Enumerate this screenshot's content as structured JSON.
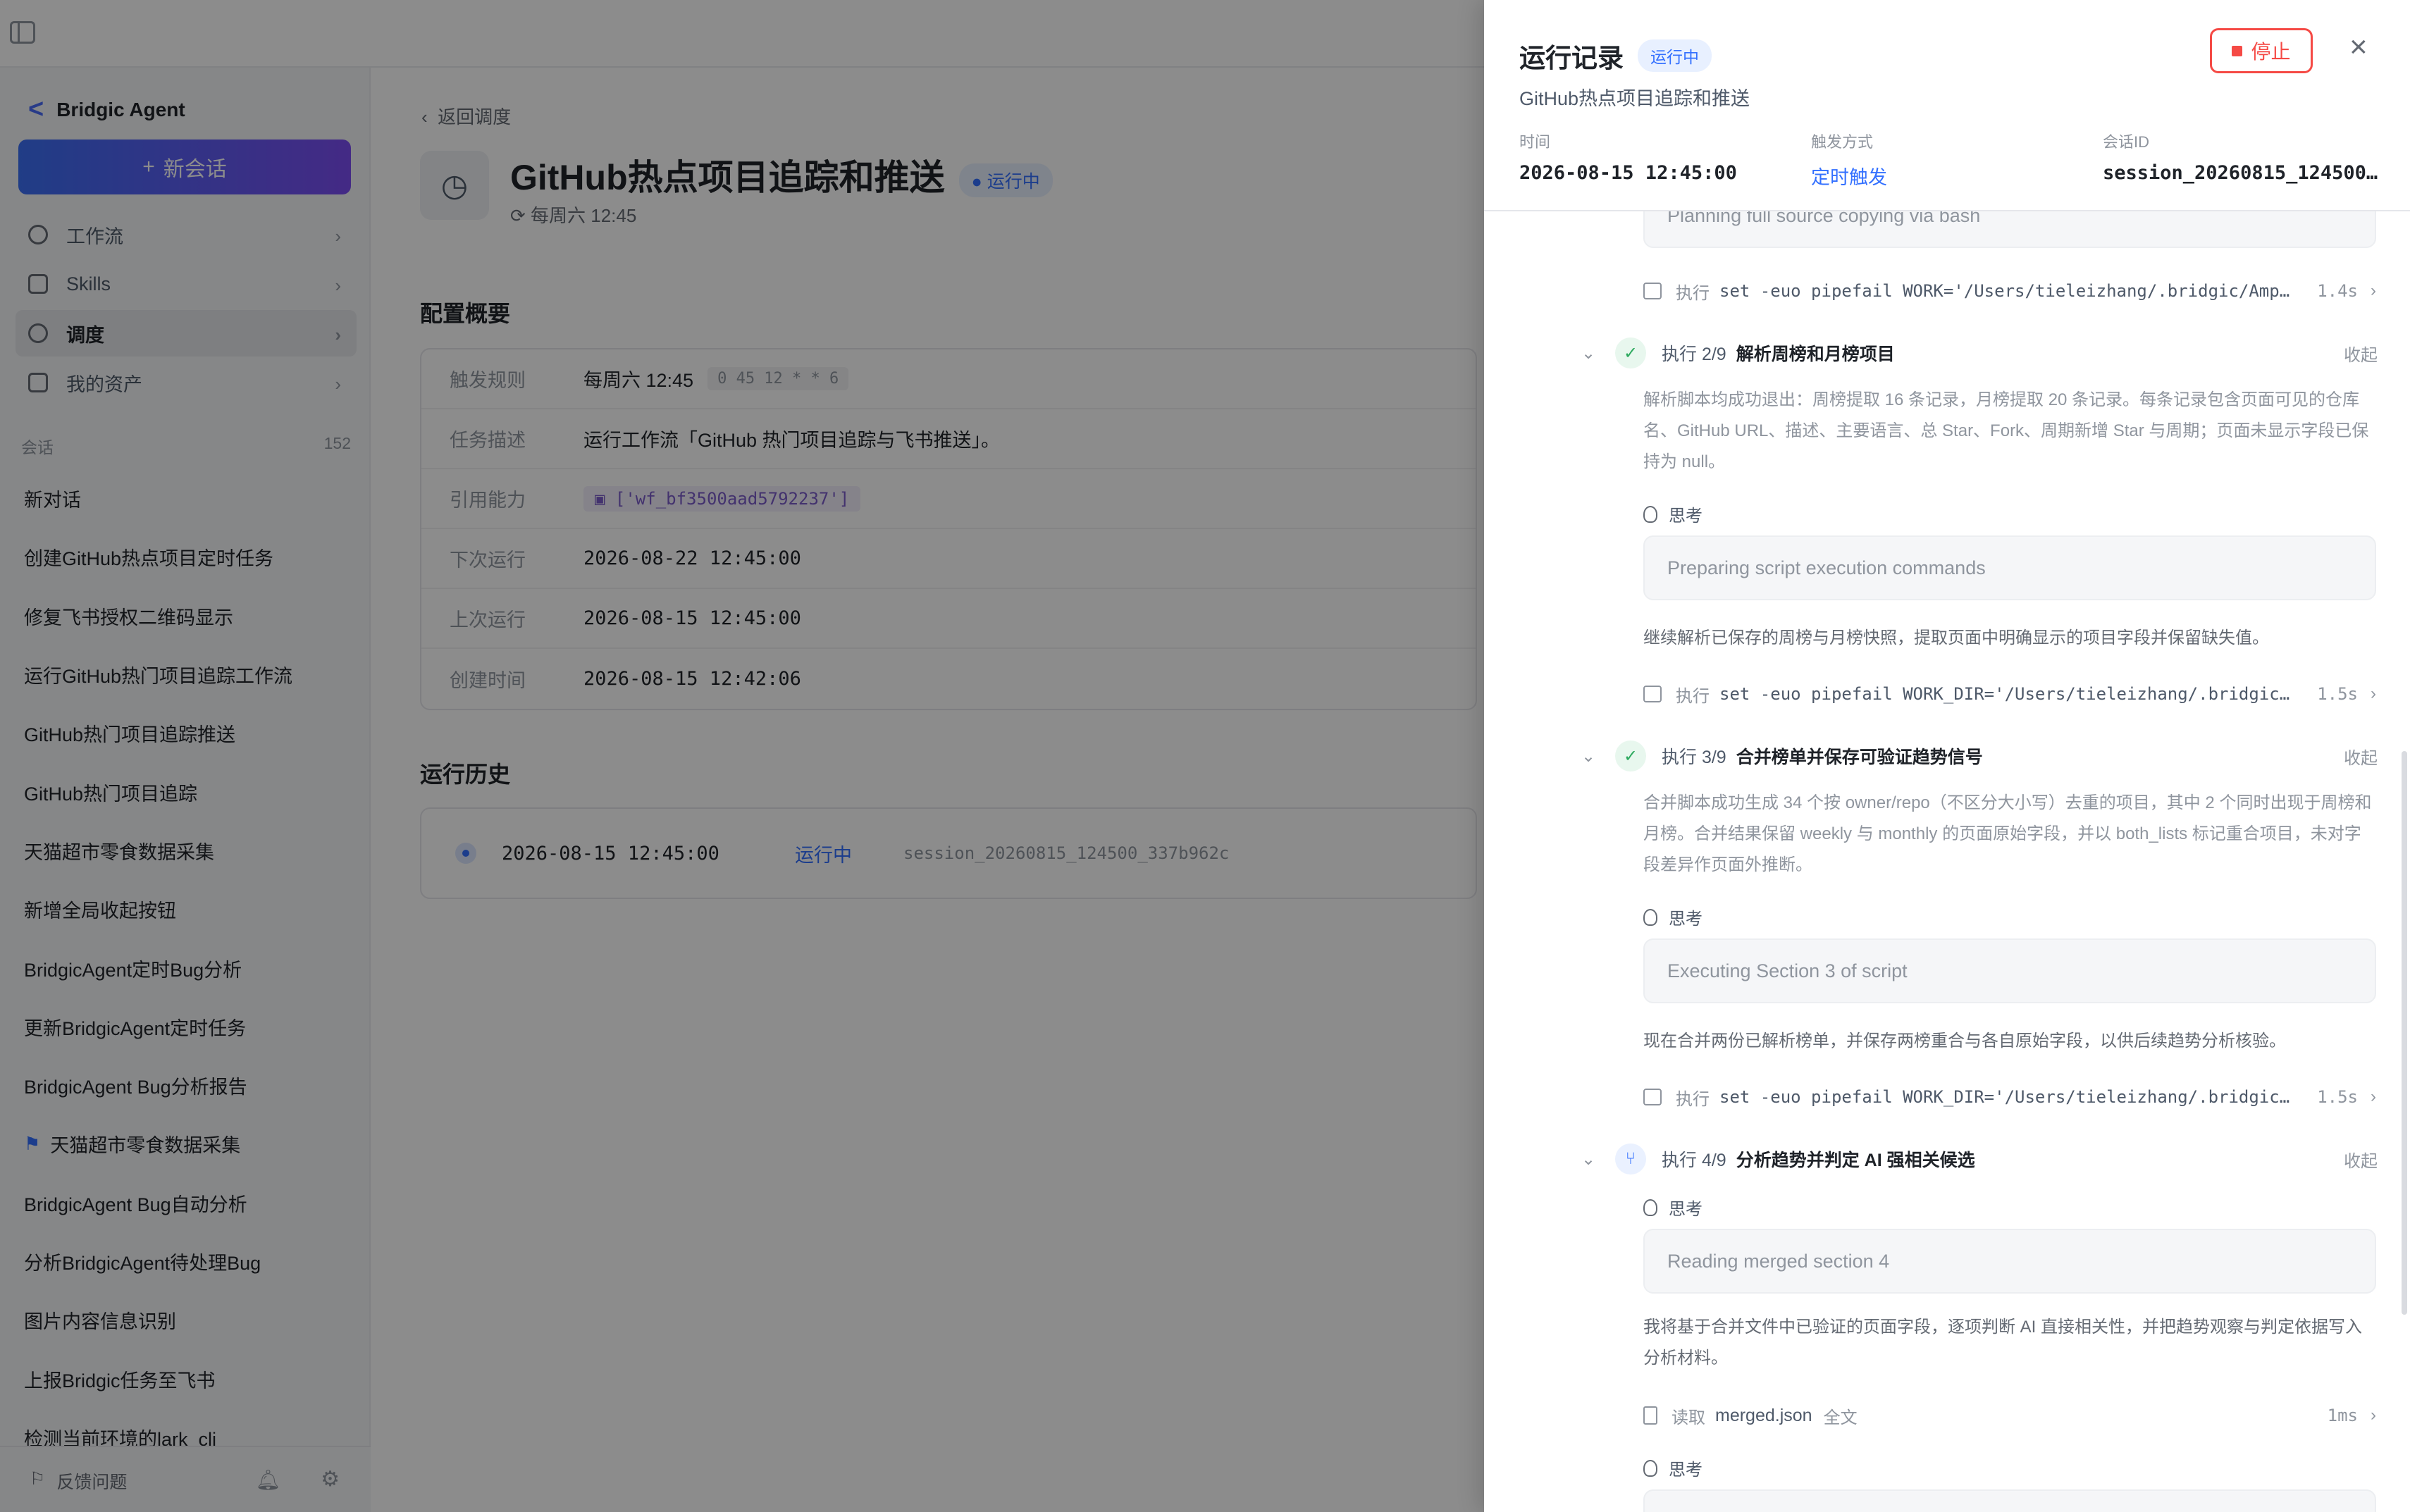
{
  "sidebar": {
    "brand": "Bridgic Agent",
    "new_chat": "新会话",
    "nav": [
      "工作流",
      "Skills",
      "调度",
      "我的资产"
    ],
    "section_label": "会话",
    "section_count": "152",
    "conversations": [
      "新对话",
      "创建GitHub热点项目定时任务",
      "修复飞书授权二维码显示",
      "运行GitHub热门项目追踪工作流",
      "GitHub热门项目追踪推送",
      "GitHub热门项目追踪",
      "天猫超市零食数据采集",
      "新增全局收起按钮",
      "BridgicAgent定时Bug分析",
      "更新BridgicAgent定时任务",
      "BridgicAgent Bug分析报告",
      "天猫超市零食数据采集",
      "BridgicAgent Bug自动分析",
      "分析BridgicAgent待处理Bug",
      "图片内容信息识别",
      "上报Bridgic任务至飞书",
      "检测当前环境的lark_cli"
    ],
    "feedback": "反馈问题"
  },
  "main": {
    "back": "返回调度",
    "title": "GitHub热点项目追踪和推送",
    "status": "运行中",
    "cron_text": "每周六 12:45",
    "config_heading": "配置概要",
    "config": {
      "trigger_label": "触发规则",
      "trigger_value": "每周六 12:45",
      "trigger_cron": "0 45 12 * * 6",
      "desc_label": "任务描述",
      "desc_value": "运行工作流「GitHub 热门项目追踪与飞书推送」。",
      "ref_label": "引用能力",
      "ref_value": "['wf_bf3500aad5792237']",
      "next_label": "下次运行",
      "next_value": "2026-08-22 12:45:00",
      "last_label": "上次运行",
      "last_value": "2026-08-15 12:45:00",
      "created_label": "创建时间",
      "created_value": "2026-08-15 12:42:06"
    },
    "history_heading": "运行历史",
    "history": [
      {
        "time": "2026-08-15 12:45:00",
        "status": "运行中",
        "session": "session_20260815_124500_337b962c"
      }
    ]
  },
  "panel": {
    "title": "运行记录",
    "status": "运行中",
    "subtitle": "GitHub热点项目追踪和推送",
    "stop": "停止",
    "time_label": "时间",
    "time_value": "2026-08-15 12:45:00",
    "trigger_label": "触发方式",
    "trigger_value": "定时触发",
    "session_label": "会话ID",
    "session_value": "session_20260815_124500…",
    "exec_label": "执行",
    "think_label": "思考",
    "fold_label": "收起",
    "bubble_top": "Planning full source copying via bash",
    "tool_1": {
      "cmd": "set -euo pipefail WORK='/Users/tieleizhang/.bridgic/Amp…",
      "dur": "1.4s"
    },
    "step2": {
      "label": "执行 2/9",
      "title": "解析周榜和月榜项目"
    },
    "step2_text": "解析脚本均成功退出：周榜提取 16 条记录，月榜提取 20 条记录。每条记录包含页面可见的仓库名、GitHub URL、描述、主要语言、总 Star、Fork、周期新增 Star 与周期；页面未显示字段已保持为 null。",
    "step2_think": "Preparing script execution commands",
    "step2_note": "继续解析已保存的周榜与月榜快照，提取页面中明确显示的项目字段并保留缺失值。",
    "tool_2": {
      "cmd": "set -euo pipefail WORK_DIR='/Users/tieleizhang/.bridgic…",
      "dur": "1.5s"
    },
    "step3": {
      "label": "执行 3/9",
      "title": "合并榜单并保存可验证趋势信号"
    },
    "step3_text": "合并脚本成功生成 34 个按 owner/repo（不区分大小写）去重的项目，其中 2 个同时出现于周榜和月榜。合并结果保留 weekly 与 monthly 的页面原始字段，并以 both_lists 标记重合项目，未对字段差异作页面外推断。",
    "step3_think": "Executing Section 3 of script",
    "step3_note": "现在合并两份已解析榜单，并保存两榜重合与各自原始字段，以供后续趋势分析核验。",
    "tool_3": {
      "cmd": "set -euo pipefail WORK_DIR='/Users/tieleizhang/.bridgic…",
      "dur": "1.5s"
    },
    "step4": {
      "label": "执行 4/9",
      "title": "分析趋势并判定 AI 强相关候选"
    },
    "step4_think": "Reading merged section 4",
    "step4_note": "我将基于合并文件中已验证的页面字段，逐项判断 AI 直接相关性，并把趋势观察与判定依据写入分析材料。",
    "read_tool": {
      "label": "读取",
      "file": "merged.json",
      "scope": "全文",
      "dur": "1ms"
    }
  }
}
